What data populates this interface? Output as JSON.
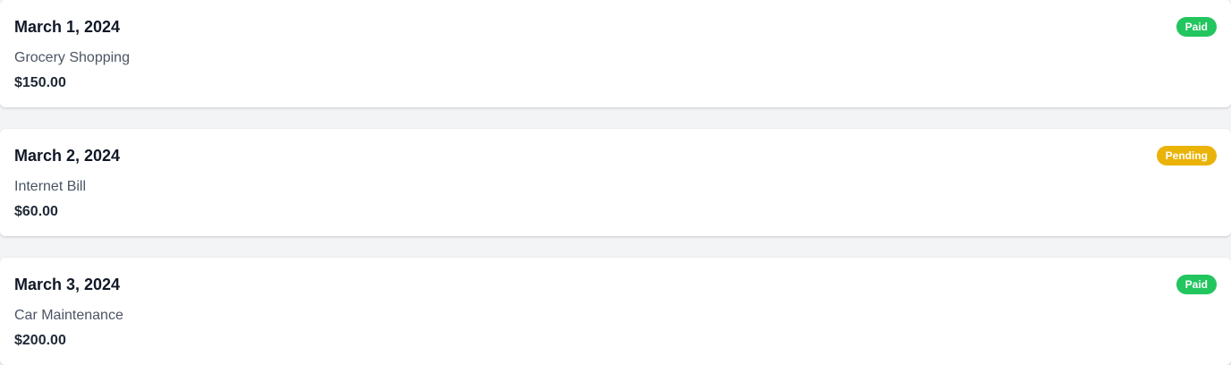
{
  "transactions": [
    {
      "date": "March 1, 2024",
      "description": "Grocery Shopping",
      "amount": "$150.00",
      "status": "Paid",
      "status_color": "#22c55e"
    },
    {
      "date": "March 2, 2024",
      "description": "Internet Bill",
      "amount": "$60.00",
      "status": "Pending",
      "status_color": "#eab308"
    },
    {
      "date": "March 3, 2024",
      "description": "Car Maintenance",
      "amount": "$200.00",
      "status": "Paid",
      "status_color": "#22c55e"
    }
  ]
}
